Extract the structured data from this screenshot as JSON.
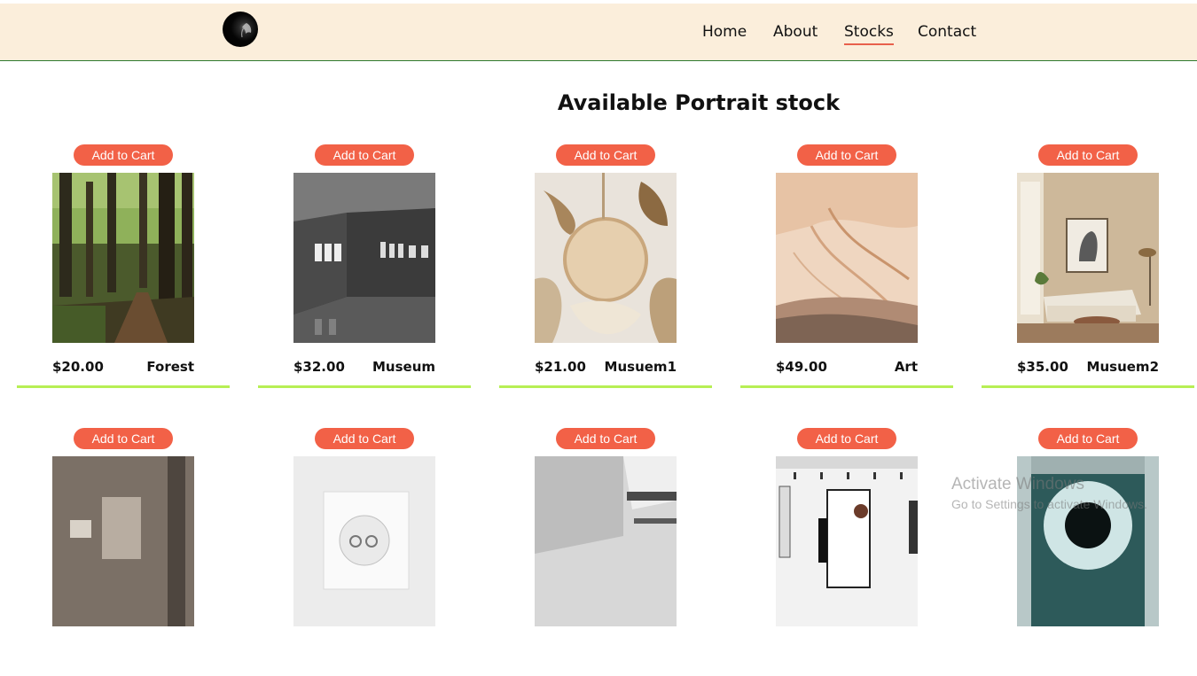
{
  "nav": {
    "items": [
      {
        "label": "Home"
      },
      {
        "label": "About"
      },
      {
        "label": "Stocks",
        "active": true
      },
      {
        "label": "Contact"
      }
    ]
  },
  "colors": {
    "header_bg": "#fbeedb",
    "accent": "#f26147",
    "card_underline": "#b7ef55"
  },
  "main": {
    "title": "Available Portrait stock",
    "add_to_cart_label": "Add to Cart",
    "products": [
      {
        "price": "$20.00",
        "name": "Forest"
      },
      {
        "price": "$32.00",
        "name": "Museum"
      },
      {
        "price": "$21.00",
        "name": "Musuem1"
      },
      {
        "price": "$49.00",
        "name": "Art"
      },
      {
        "price": "$35.00",
        "name": "Musuem2"
      }
    ]
  },
  "watermark": {
    "line1": "Activate Windows",
    "line2": "Go to Settings to activate Windows."
  }
}
